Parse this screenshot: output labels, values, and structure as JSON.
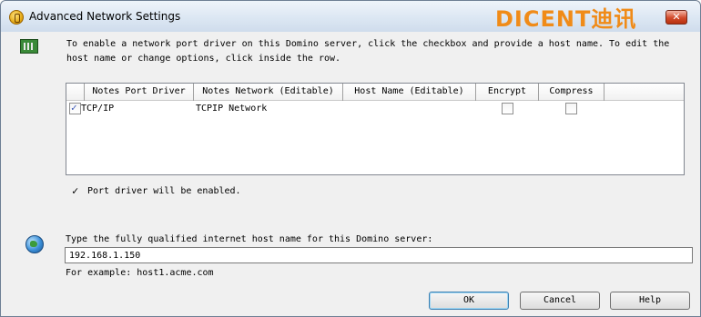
{
  "window": {
    "title": "Advanced Network Settings",
    "brand_text": "DICENT迪讯",
    "close_label": "✕"
  },
  "intro": {
    "text": "To enable a network port driver on this Domino server, click the checkbox and provide a host name. To edit the\nhost name or change options, click inside the row."
  },
  "table": {
    "headers": [
      "Notes Port Driver",
      "Notes Network (Editable)",
      "Host Name (Editable)",
      "Encrypt",
      "Compress"
    ],
    "rows": [
      {
        "enabled": true,
        "port_driver": "TCP/IP",
        "network": "TCPIP Network",
        "host_name": "",
        "encrypt": false,
        "compress": false
      }
    ]
  },
  "status": {
    "text": "Port driver will be enabled."
  },
  "host": {
    "label": "Type the fully qualified internet host name for this Domino server:",
    "value": "192.168.1.150",
    "example": "For example: host1.acme.com"
  },
  "buttons": {
    "ok": "OK",
    "cancel": "Cancel",
    "help": "Help"
  },
  "colors": {
    "brand": "#f08b18",
    "checkmark": "#3d59b5",
    "title_bar": "#dce7f3"
  },
  "icons": {
    "app": "notes-app-icon",
    "port": "network-card-icon",
    "host": "globe-icon"
  }
}
